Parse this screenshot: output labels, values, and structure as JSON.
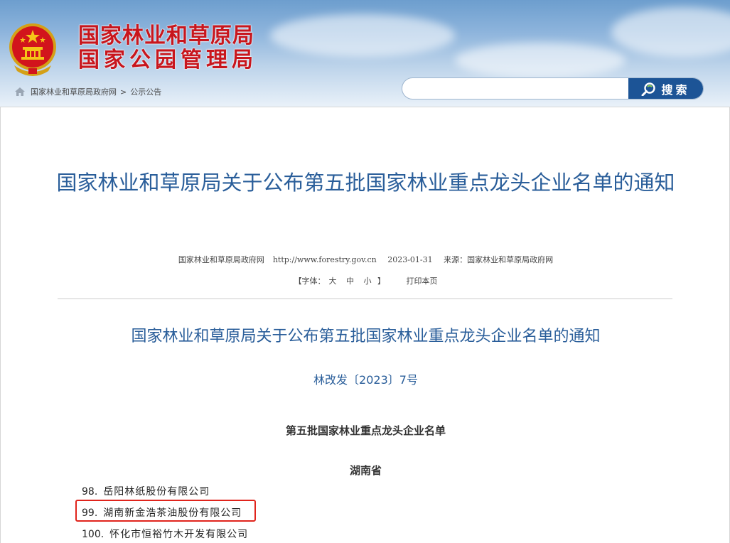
{
  "header": {
    "title_line1": "国家林业和草原局",
    "title_line2": "国家公园管理局",
    "title_color": "#c8161d",
    "breadcrumb": {
      "home": "国家林业和草原局政府网",
      "separator": ">",
      "current": "公示公告"
    },
    "search": {
      "placeholder": "",
      "button_label": "搜索",
      "button_color": "#1c5496"
    }
  },
  "article": {
    "title": "国家林业和草原局关于公布第五批国家林业重点龙头企业名单的通知",
    "meta": {
      "publisher": "国家林业和草原局政府网",
      "url": "http://www.forestry.gov.cn",
      "date": "2023-01-31",
      "source": "来源：国家林业和草原局政府网"
    },
    "font_size": {
      "label_open": "【字体：",
      "large": "大",
      "medium": "中",
      "small": "小",
      "label_close": "】",
      "print": "打印本页"
    },
    "body_title": "国家林业和草原局关于公布第五批国家林业重点龙头企业名单的通知",
    "doc_number": "林改发〔2023〕7号",
    "list_heading": "第五批国家林业重点龙头企业名单",
    "province": "湖南省",
    "companies": [
      {
        "num": "98.",
        "name": "岳阳林纸股份有限公司"
      },
      {
        "num": "99.",
        "name": "湖南新金浩茶油股份有限公司"
      },
      {
        "num": "100.",
        "name": "怀化市恒裕竹木开发有限公司"
      }
    ],
    "title_color": "#2a5e9a",
    "highlight_color": "#e0241c"
  }
}
